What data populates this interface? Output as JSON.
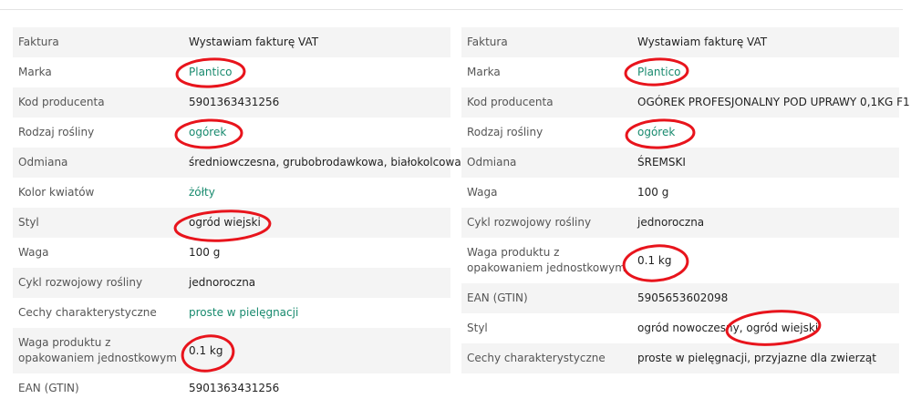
{
  "left_table": {
    "rows": [
      {
        "label": "Faktura",
        "value": "Wystawiam fakturę VAT"
      },
      {
        "label": "Marka",
        "value": "Plantico"
      },
      {
        "label": "Kod producenta",
        "value": "5901363431256"
      },
      {
        "label": "Rodzaj rośliny",
        "value": "ogórek"
      },
      {
        "label": "Odmiana",
        "value": "średniowczesna, grubobrodawkowa, białokolcowa"
      },
      {
        "label": "Kolor kwiatów",
        "value": "żółty"
      },
      {
        "label": "Styl",
        "value": "ogród wiejski"
      },
      {
        "label": "Waga",
        "value": "100 g"
      },
      {
        "label": "Cykl rozwojowy rośliny",
        "value": "jednoroczna"
      },
      {
        "label": "Cechy charakterystyczne",
        "value": "proste w pielęgnacji"
      },
      {
        "label": "Waga produktu z opakowaniem jednostkowym",
        "value": "0.1 kg"
      },
      {
        "label": "EAN (GTIN)",
        "value": "5901363431256"
      }
    ]
  },
  "right_table": {
    "rows": [
      {
        "label": "Faktura",
        "value": "Wystawiam fakturę VAT"
      },
      {
        "label": "Marka",
        "value": "Plantico"
      },
      {
        "label": "Kod producenta",
        "value": "OGÓREK PROFESJONALNY POD UPRAWY 0,1KG F1"
      },
      {
        "label": "Rodzaj rośliny",
        "value": "ogórek"
      },
      {
        "label": "Odmiana",
        "value": "ŚREMSKI"
      },
      {
        "label": "Waga",
        "value": "100 g"
      },
      {
        "label": "Cykl rozwojowy rośliny",
        "value": "jednoroczna"
      },
      {
        "label": "Waga produktu z opakowaniem jednostkowym",
        "value": "0.1 kg"
      },
      {
        "label": "EAN (GTIN)",
        "value": "5905653602098"
      },
      {
        "label": "Styl",
        "value": "ogród nowoczesny, ogród wiejski"
      },
      {
        "label": "Cechy charakterystyczne",
        "value": "proste w pielęgnacji, przyjazne dla zwierząt"
      }
    ]
  },
  "colors": {
    "link": "#188a6e",
    "annotation": "#e8141c",
    "row_shade": "#f4f4f4"
  }
}
